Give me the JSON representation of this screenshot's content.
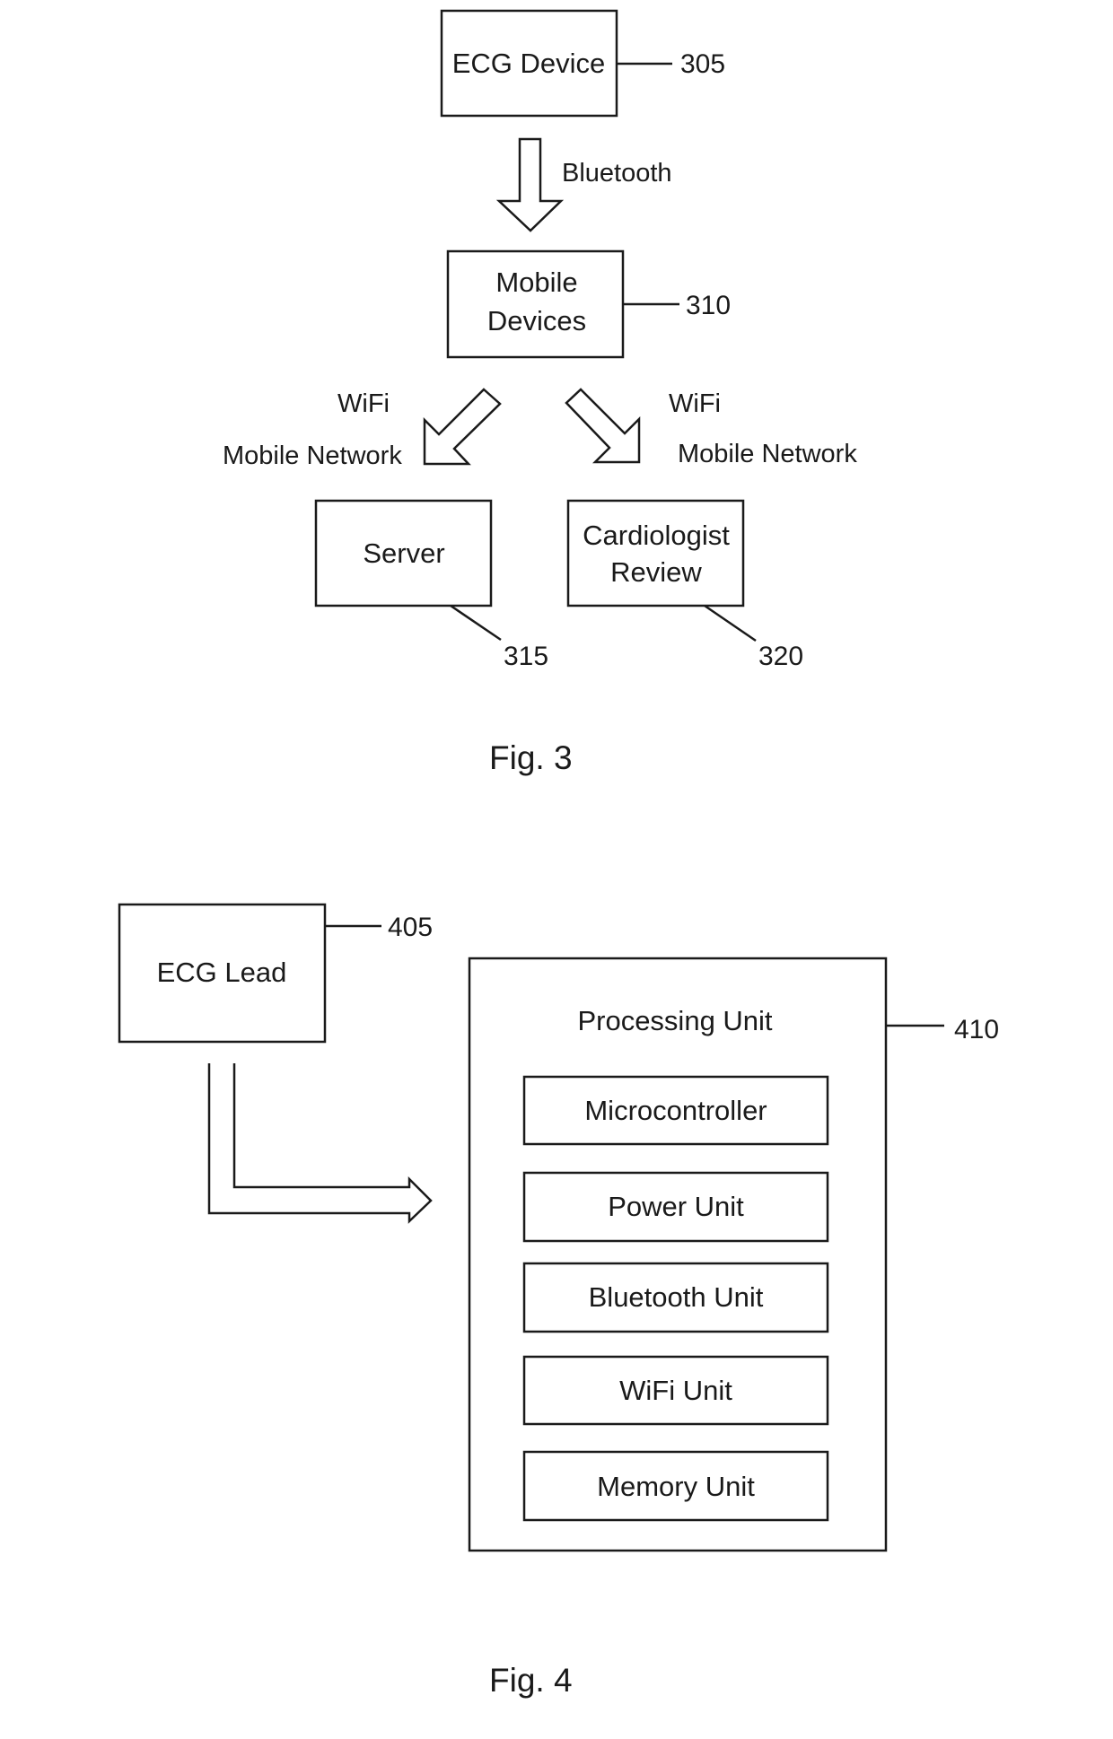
{
  "fig3": {
    "caption": "Fig. 3",
    "nodes": {
      "ecg_device": {
        "label": "ECG Device",
        "ref": "305"
      },
      "mobile_devices": {
        "label_line1": "Mobile",
        "label_line2": "Devices",
        "ref": "310"
      },
      "server": {
        "label": "Server",
        "ref": "315"
      },
      "cardiologist_review": {
        "label_line1": "Cardiologist",
        "label_line2": "Review",
        "ref": "320"
      }
    },
    "edges": {
      "ecg_to_mobile": {
        "label": "Bluetooth"
      },
      "mobile_to_server": {
        "label_line1": "WiFi",
        "label_line2": "Mobile Network"
      },
      "mobile_to_cardiologist": {
        "label_line1": "WiFi",
        "label_line2": "Mobile Network"
      }
    }
  },
  "fig4": {
    "caption": "Fig. 4",
    "ecg_lead": {
      "label": "ECG Lead",
      "ref": "405"
    },
    "processing_unit": {
      "label": "Processing Unit",
      "ref": "410",
      "components": [
        "Microcontroller",
        "Power Unit",
        "Bluetooth Unit",
        "WiFi Unit",
        "Memory Unit"
      ]
    }
  }
}
